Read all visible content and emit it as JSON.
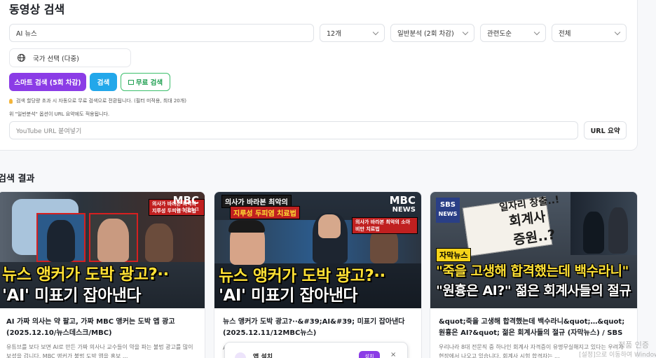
{
  "page_title": "동영상 검색",
  "search": {
    "query": "AI 뉴스",
    "count": "12개",
    "analysis": "일반분석 (2회 차감)",
    "sort": "관련도순",
    "period": "전체"
  },
  "country": {
    "label": "국가 선택 (다중)",
    "icon": "globe-icon"
  },
  "buttons": {
    "smart": "스마트 검색 (5회 차감)",
    "search": "검색",
    "free": "무료 검색"
  },
  "hints": {
    "line1": "검색 할당량 초과 시 자동으로 무료 검색으로 전환됩니다. (필터 미적용, 최대 20개)",
    "line2": "위 \"일반분석\" 옵션이 URL 요약에도 적용됩니다."
  },
  "url": {
    "placeholder": "YouTube URL 붙여넣기",
    "button": "URL 요약"
  },
  "results_title": "검색 결과",
  "colors": {
    "purple": "#8b3ce6",
    "blue": "#22a7ea",
    "green": "#21a052"
  },
  "cards": [
    {
      "title": "AI 가짜 의사는 약 팔고, 가짜 MBC 앵커는 도박 앱 광고 (2025.12.10/뉴스데스크/MBC)",
      "desc": "유튜브를 보다 보면 AI로 만든 가짜 의사나 교수들이 약을 파는 불법 광고를 많이 보셨을 겁니다. MBC 앵커가 불법 도박 앱을 홍보 ...",
      "thumb": {
        "logo": "MBC",
        "logo_sub": "뉴스데스크",
        "banner": "의사가 바라본 최악의 지루성 두피염 치료법",
        "line1": "뉴스 앵커가 도박 광고?··",
        "line2": "'AI' 미표기 잡아낸다"
      }
    },
    {
      "title": "뉴스 앵커가 도박 광고?··&#39;AI&#39; 미표기 잡아낸다 (2025.12.11/12MBC뉴스)",
      "desc": "A C",
      "thumb": {
        "logo": "MBC",
        "logo_sub": "NEWS",
        "banner1": "의사가 바라본 최악의",
        "banner2": "지루성 두피염 치료법",
        "banner3": "의사가 바라본 최악의 소아비만 치료법",
        "line1": "뉴스 앵커가 도박 광고?··",
        "line2": "'AI' 미표기 잡아낸다"
      },
      "popup": {
        "label": "앱 설치",
        "button": "설치",
        "close": "×"
      }
    },
    {
      "title": "&quot;죽을 고생해 합격했는데 백수라니&quot;…&quot; 원흉은 AI?&quot; 젊은 회계사들의 절규 (자막뉴스) / SBS",
      "desc": "우리나라 8대 전문직 중 하나인 회계사 자격증이 유명무실해지고 있다는 우려가 현장에서 나오고 있습니다. 회계사 시험 합격자는 ...",
      "thumb": {
        "logo": "SBS",
        "logo_sub": "NEWS",
        "sign1": "일자리 창출..!",
        "sign2": "회계사",
        "sign3": "증원..?",
        "tag": "자막뉴스",
        "line1": "\"죽을 고생해 합격했는데 백수라니\"",
        "line2": "\"원흉은 AI?\" 젊은 회계사들의 절규"
      }
    }
  ],
  "watermark": {
    "line1": "정품 인증",
    "line2": "[설정]으로 이동하여 Windows"
  }
}
